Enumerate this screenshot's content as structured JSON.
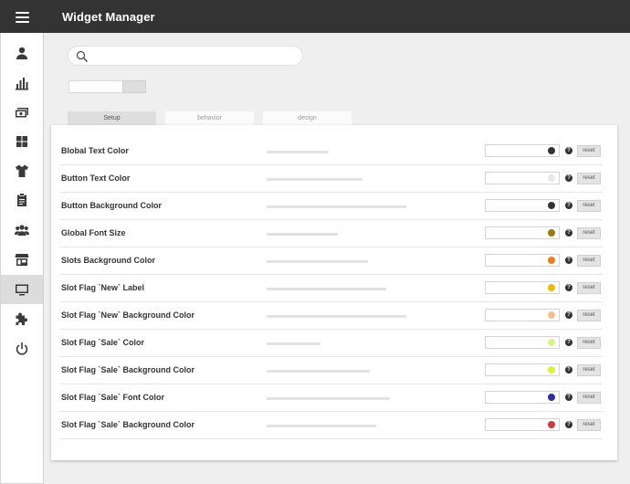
{
  "app": {
    "title": "Widget Manager"
  },
  "sidebar": {
    "items": [
      {
        "icon": "user-icon"
      },
      {
        "icon": "bar-chart-icon"
      },
      {
        "icon": "money-icon"
      },
      {
        "icon": "grid-icon"
      },
      {
        "icon": "tshirt-icon"
      },
      {
        "icon": "clipboard-icon"
      },
      {
        "icon": "users-icon"
      },
      {
        "icon": "store-icon"
      },
      {
        "icon": "monitor-icon",
        "active": true
      },
      {
        "icon": "puzzle-icon"
      },
      {
        "icon": "power-icon"
      }
    ]
  },
  "search": {
    "value": "",
    "placeholder": ""
  },
  "combo": {
    "value": ""
  },
  "tabs": [
    {
      "label": "Setup",
      "active": true
    },
    {
      "label": "behavior",
      "active": false
    },
    {
      "label": "design",
      "active": false
    }
  ],
  "settings": {
    "help_label": "?",
    "reset_label": "reset",
    "rows": [
      {
        "label": "Blobal Text Color",
        "value": "",
        "swatch": "#333333"
      },
      {
        "label": "Button Text Color",
        "value": "",
        "swatch": "#e8e8e8"
      },
      {
        "label": "Button Background Color",
        "value": "",
        "swatch": "#333333"
      },
      {
        "label": "Global Font Size",
        "value": "",
        "swatch": "#a07a10"
      },
      {
        "label": "Slots Background Color",
        "value": "",
        "swatch": "#f07f1c"
      },
      {
        "label": "Slot Flag `New` Label",
        "value": "",
        "swatch": "#f5b800"
      },
      {
        "label": "Slot Flag `New` Background Color",
        "value": "",
        "swatch": "#f7c08a"
      },
      {
        "label": "Slot Flag `Sale` Color",
        "value": "",
        "swatch": "#d4f58a"
      },
      {
        "label": "Slot Flag `Sale` Background Color",
        "value": "",
        "swatch": "#d6f53a"
      },
      {
        "label": "Slot Flag `Sale` Font Color",
        "value": "",
        "swatch": "#2d2fa0"
      },
      {
        "label": "Slot Flag `Sale` Background Color",
        "value": "",
        "swatch": "#d03b3b"
      }
    ]
  }
}
